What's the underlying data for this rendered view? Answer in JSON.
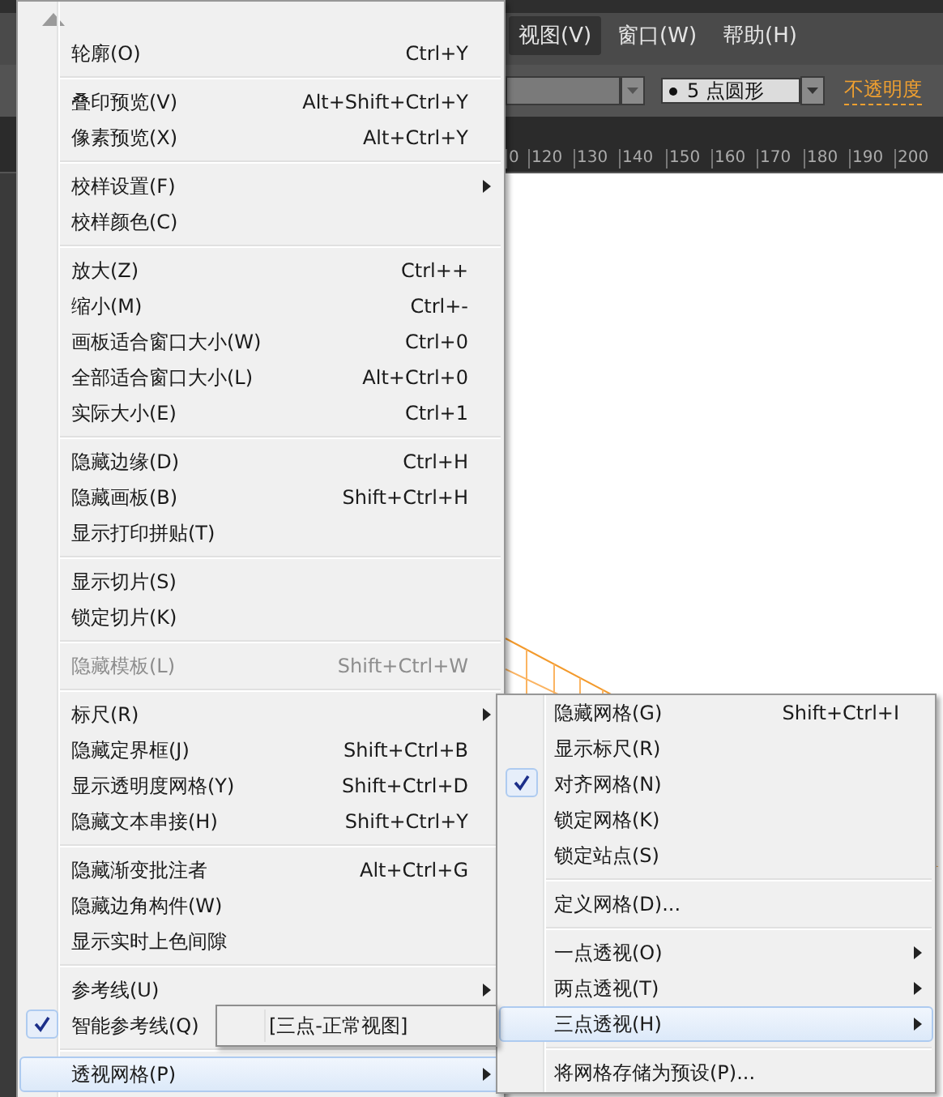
{
  "menubar": [
    {
      "label": "视图(V)",
      "selected": true
    },
    {
      "label": "窗口(W)",
      "selected": false
    },
    {
      "label": "帮助(H)",
      "selected": false
    }
  ],
  "control_bar": {
    "brush": {
      "value": "5 点圆形"
    },
    "opacity_link": "不透明度"
  },
  "ruler": [
    "0",
    "120",
    "130",
    "140",
    "150",
    "160",
    "170",
    "180",
    "190",
    "200"
  ],
  "view_menu": {
    "items": [
      {
        "kind": "item",
        "label": "轮廓(O)",
        "shortcut": "Ctrl+Y",
        "submenu": false,
        "checked": false,
        "disabled": false,
        "selected": false
      },
      {
        "kind": "separator"
      },
      {
        "kind": "item",
        "label": "叠印预览(V)",
        "shortcut": "Alt+Shift+Ctrl+Y",
        "submenu": false,
        "checked": false,
        "disabled": false,
        "selected": false
      },
      {
        "kind": "item",
        "label": "像素预览(X)",
        "shortcut": "Alt+Ctrl+Y",
        "submenu": false,
        "checked": false,
        "disabled": false,
        "selected": false
      },
      {
        "kind": "separator"
      },
      {
        "kind": "item",
        "label": "校样设置(F)",
        "submenu": true,
        "checked": false,
        "disabled": false,
        "selected": false
      },
      {
        "kind": "item",
        "label": "校样颜色(C)",
        "submenu": false,
        "checked": false,
        "disabled": false,
        "selected": false
      },
      {
        "kind": "separator"
      },
      {
        "kind": "item",
        "label": "放大(Z)",
        "shortcut": "Ctrl++",
        "submenu": false,
        "checked": false,
        "disabled": false,
        "selected": false
      },
      {
        "kind": "item",
        "label": "缩小(M)",
        "shortcut": "Ctrl+-",
        "submenu": false,
        "checked": false,
        "disabled": false,
        "selected": false
      },
      {
        "kind": "item",
        "label": "画板适合窗口大小(W)",
        "shortcut": "Ctrl+0",
        "submenu": false,
        "checked": false,
        "disabled": false,
        "selected": false
      },
      {
        "kind": "item",
        "label": "全部适合窗口大小(L)",
        "shortcut": "Alt+Ctrl+0",
        "submenu": false,
        "checked": false,
        "disabled": false,
        "selected": false
      },
      {
        "kind": "item",
        "label": "实际大小(E)",
        "shortcut": "Ctrl+1",
        "submenu": false,
        "checked": false,
        "disabled": false,
        "selected": false
      },
      {
        "kind": "separator"
      },
      {
        "kind": "item",
        "label": "隐藏边缘(D)",
        "shortcut": "Ctrl+H",
        "submenu": false,
        "checked": false,
        "disabled": false,
        "selected": false
      },
      {
        "kind": "item",
        "label": "隐藏画板(B)",
        "shortcut": "Shift+Ctrl+H",
        "submenu": false,
        "checked": false,
        "disabled": false,
        "selected": false
      },
      {
        "kind": "item",
        "label": "显示打印拼贴(T)",
        "submenu": false,
        "checked": false,
        "disabled": false,
        "selected": false
      },
      {
        "kind": "separator"
      },
      {
        "kind": "item",
        "label": "显示切片(S)",
        "submenu": false,
        "checked": false,
        "disabled": false,
        "selected": false
      },
      {
        "kind": "item",
        "label": "锁定切片(K)",
        "submenu": false,
        "checked": false,
        "disabled": false,
        "selected": false
      },
      {
        "kind": "separator"
      },
      {
        "kind": "item",
        "label": "隐藏模板(L)",
        "shortcut": "Shift+Ctrl+W",
        "submenu": false,
        "checked": false,
        "disabled": true,
        "selected": false
      },
      {
        "kind": "separator"
      },
      {
        "kind": "item",
        "label": "标尺(R)",
        "submenu": true,
        "checked": false,
        "disabled": false,
        "selected": false
      },
      {
        "kind": "item",
        "label": "隐藏定界框(J)",
        "shortcut": "Shift+Ctrl+B",
        "submenu": false,
        "checked": false,
        "disabled": false,
        "selected": false
      },
      {
        "kind": "item",
        "label": "显示透明度网格(Y)",
        "shortcut": "Shift+Ctrl+D",
        "submenu": false,
        "checked": false,
        "disabled": false,
        "selected": false
      },
      {
        "kind": "item",
        "label": "隐藏文本串接(H)",
        "shortcut": "Shift+Ctrl+Y",
        "submenu": false,
        "checked": false,
        "disabled": false,
        "selected": false
      },
      {
        "kind": "separator"
      },
      {
        "kind": "item",
        "label": "隐藏渐变批注者",
        "shortcut": "Alt+Ctrl+G",
        "submenu": false,
        "checked": false,
        "disabled": false,
        "selected": false
      },
      {
        "kind": "item",
        "label": "隐藏边角构件(W)",
        "submenu": false,
        "checked": false,
        "disabled": false,
        "selected": false
      },
      {
        "kind": "item",
        "label": "显示实时上色间隙",
        "submenu": false,
        "checked": false,
        "disabled": false,
        "selected": false
      },
      {
        "kind": "separator"
      },
      {
        "kind": "item",
        "label": "参考线(U)",
        "submenu": true,
        "checked": false,
        "disabled": false,
        "selected": false
      },
      {
        "kind": "item",
        "label": "智能参考线(Q)",
        "submenu": false,
        "checked": true,
        "disabled": false,
        "selected": false
      },
      {
        "kind": "separator"
      },
      {
        "kind": "item",
        "label": "透视网格(P)",
        "submenu": true,
        "checked": false,
        "disabled": false,
        "selected": true
      }
    ]
  },
  "perspective_submenu": {
    "items": [
      {
        "kind": "item",
        "label": "隐藏网格(G)",
        "shortcut": "Shift+Ctrl+I",
        "submenu": false,
        "checked": false,
        "disabled": false,
        "selected": false
      },
      {
        "kind": "item",
        "label": "显示标尺(R)",
        "submenu": false,
        "checked": false,
        "disabled": false,
        "selected": false
      },
      {
        "kind": "item",
        "label": "对齐网格(N)",
        "submenu": false,
        "checked": true,
        "disabled": false,
        "selected": false
      },
      {
        "kind": "item",
        "label": "锁定网格(K)",
        "submenu": false,
        "checked": false,
        "disabled": false,
        "selected": false
      },
      {
        "kind": "item",
        "label": "锁定站点(S)",
        "submenu": false,
        "checked": false,
        "disabled": false,
        "selected": false
      },
      {
        "kind": "separator"
      },
      {
        "kind": "item",
        "label": "定义网格(D)...",
        "submenu": false,
        "checked": false,
        "disabled": false,
        "selected": false
      },
      {
        "kind": "separator"
      },
      {
        "kind": "item",
        "label": "一点透视(O)",
        "submenu": true,
        "checked": false,
        "disabled": false,
        "selected": false
      },
      {
        "kind": "item",
        "label": "两点透视(T)",
        "submenu": true,
        "checked": false,
        "disabled": false,
        "selected": false
      },
      {
        "kind": "item",
        "label": "三点透视(H)",
        "submenu": true,
        "checked": false,
        "disabled": false,
        "selected": true
      },
      {
        "kind": "separator"
      },
      {
        "kind": "item",
        "label": "将网格存储为预设(P)...",
        "submenu": false,
        "checked": false,
        "disabled": false,
        "selected": false
      }
    ]
  },
  "tooltip": "[三点-正常视图]"
}
